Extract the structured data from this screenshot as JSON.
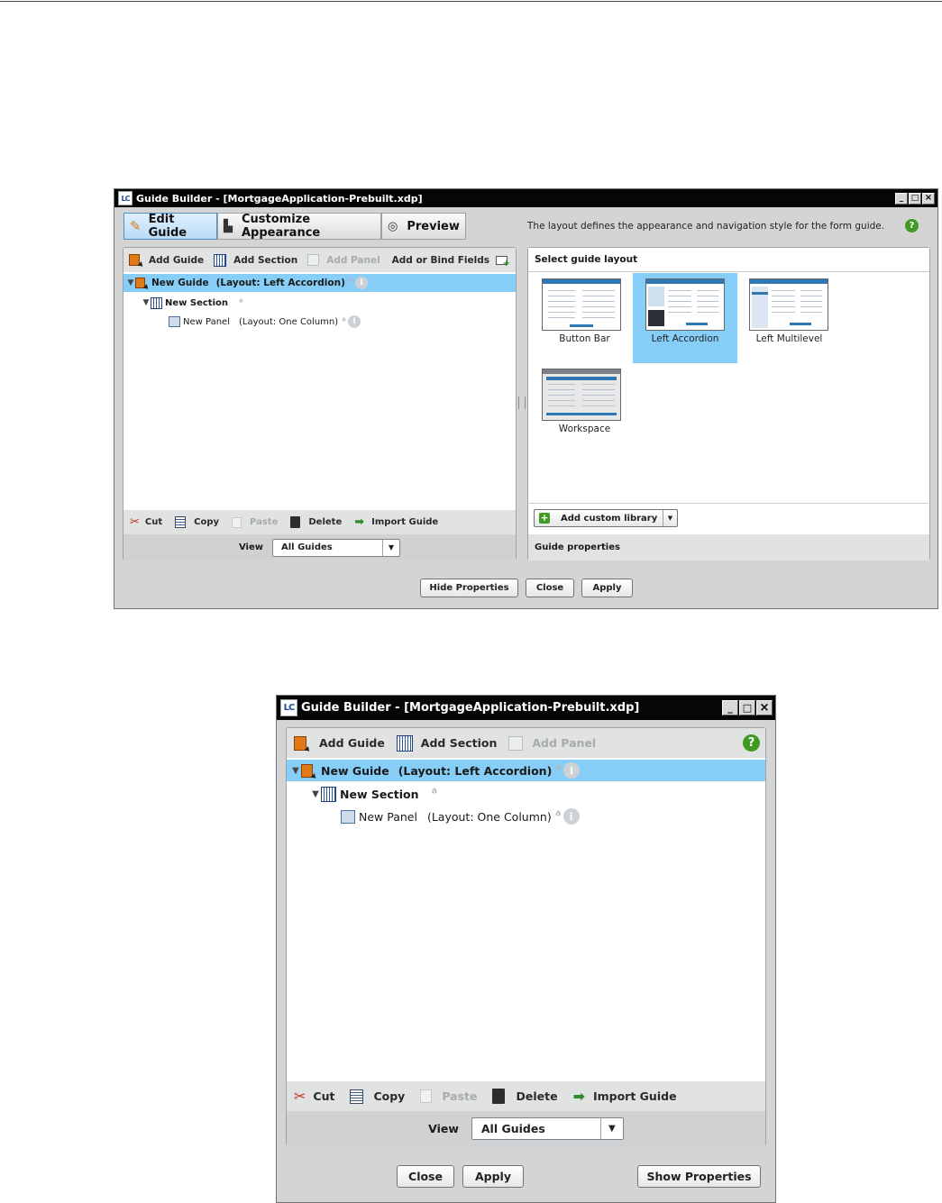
{
  "top": {
    "title": "Guide Builder - [MortgageApplication-Prebuilt.xdp]",
    "logo": "LC",
    "tabs": [
      {
        "label": "Edit Guide",
        "icon": "pencil-icon"
      },
      {
        "label": "Customize Appearance",
        "icon": "appearance-icon"
      },
      {
        "label": "Preview",
        "icon": "preview-icon"
      }
    ],
    "hint": "The layout defines the appearance and navigation style for the form guide.",
    "toolbar": {
      "add_guide": "Add Guide",
      "add_section": "Add Section",
      "add_panel": "Add Panel",
      "add_bind": "Add or Bind Fields"
    },
    "tree": {
      "guide": "New Guide",
      "guide_layout": "(Layout: Left Accordion)",
      "section": "New Section",
      "panel": "New Panel",
      "panel_layout": "(Layout: One Column)"
    },
    "bottom_toolbar": {
      "cut": "Cut",
      "copy": "Copy",
      "paste": "Paste",
      "delete": "Delete",
      "import": "Import Guide"
    },
    "view_label": "View",
    "view_value": "All Guides",
    "layout_panel": {
      "header": "Select guide layout",
      "layouts": [
        "Button Bar",
        "Left Accordion",
        "Left Multilevel",
        "Workspace"
      ],
      "selected": "Left Accordion",
      "add_custom": "Add custom library",
      "guide_properties": "Guide properties"
    },
    "buttons": {
      "hide_properties": "Hide Properties",
      "close": "Close",
      "apply": "Apply"
    }
  },
  "bottom": {
    "title": "Guide Builder - [MortgageApplication-Prebuilt.xdp]",
    "logo": "LC",
    "toolbar": {
      "add_guide": "Add Guide",
      "add_section": "Add Section",
      "add_panel": "Add Panel"
    },
    "tree": {
      "guide": "New Guide",
      "guide_layout": "(Layout: Left Accordion)",
      "section": "New Section",
      "panel": "New Panel",
      "panel_layout": "(Layout: One Column)"
    },
    "bottom_toolbar": {
      "cut": "Cut",
      "copy": "Copy",
      "paste": "Paste",
      "delete": "Delete",
      "import": "Import Guide"
    },
    "view_label": "View",
    "view_value": "All Guides",
    "buttons": {
      "close": "Close",
      "apply": "Apply",
      "show_properties": "Show Properties"
    }
  },
  "colors": {
    "selection": "#86cef7",
    "titlebar": "#060606",
    "accent_green": "#3e9a22",
    "guide_orange": "#e07a18"
  }
}
